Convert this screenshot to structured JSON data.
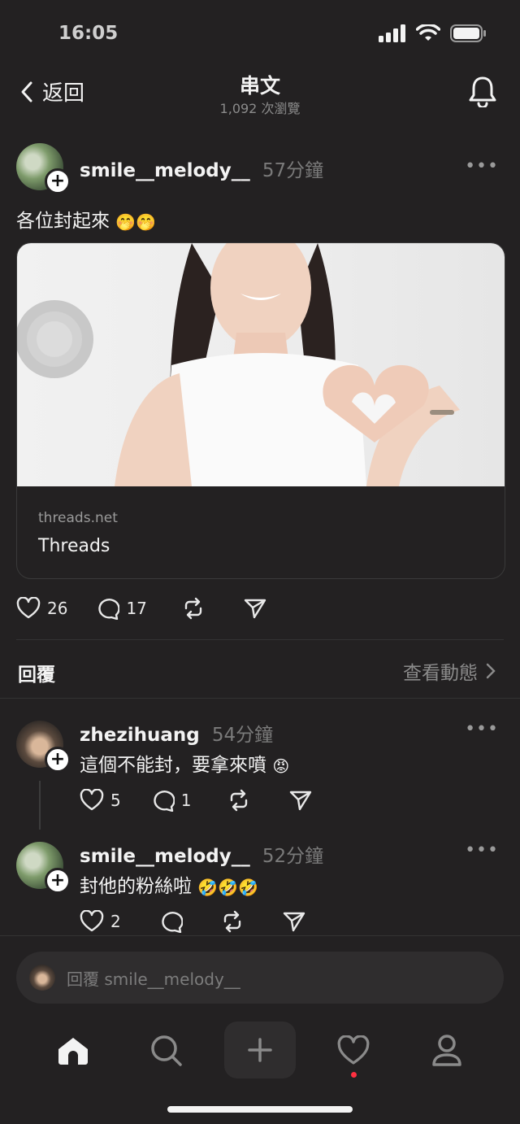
{
  "status": {
    "time": "16:05"
  },
  "nav": {
    "back_label": "返回",
    "title": "串文",
    "views": "1,092 次瀏覽"
  },
  "post": {
    "username": "smile__melody__",
    "time": "57分鐘",
    "text": "各位封起來",
    "link_domain": "threads.net",
    "link_title": "Threads",
    "likes": "26",
    "comments": "17"
  },
  "replies_section": {
    "label": "回覆",
    "view_activity": "查看動態"
  },
  "replies": [
    {
      "username": "zhezihuang",
      "time": "54分鐘",
      "text": "這個不能封，要拿來噴",
      "likes": "5",
      "comments": "1"
    },
    {
      "username": "smile__melody__",
      "time": "52分鐘",
      "text": "封他的粉絲啦",
      "likes": "2",
      "comments": ""
    }
  ],
  "reply_bar": {
    "placeholder": "回覆 smile__melody__"
  },
  "icons": {
    "back": "chevron-left-icon",
    "bell": "bell-icon",
    "heart": "heart-icon",
    "comment": "comment-icon",
    "repost": "repost-icon",
    "share": "send-icon",
    "home": "home-icon",
    "search": "search-icon",
    "compose": "plus-icon",
    "activity": "heart-icon",
    "profile": "person-icon"
  },
  "colors": {
    "background": "#232122",
    "text": "#f3f3f3",
    "muted": "#7a7a7a",
    "notification_dot": "#ff3040"
  }
}
